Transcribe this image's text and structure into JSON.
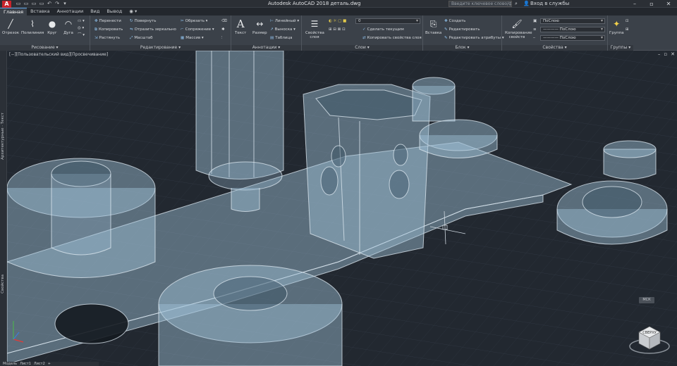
{
  "window": {
    "logo": "A",
    "title": "Autodesk AutoCAD 2018   деталь.dwg",
    "search_placeholder": "Введите ключевое слово/фразу",
    "signin": "Вход в службы"
  },
  "qat": [
    "▭",
    "▭",
    "▭",
    "▭",
    "↶",
    "↷",
    "▾"
  ],
  "tabs": [
    "Главная",
    "Вставка",
    "Аннотации",
    "Вид",
    "Вывод",
    "◉ ▾"
  ],
  "ribbon": {
    "draw": {
      "title": "Рисование ▾",
      "tools": [
        {
          "label": "Отрезок",
          "icon": "╱"
        },
        {
          "label": "Полилиния",
          "icon": "⌇"
        },
        {
          "label": "Круг",
          "icon": "●"
        },
        {
          "label": "Дуга",
          "icon": "◠"
        }
      ],
      "small": [
        "▭ ▾",
        "◎ ▾",
        "⌒ ▾"
      ]
    },
    "modify": {
      "title": "Редактирование ▾",
      "col1": [
        "Перенести",
        "Копировать",
        "Растянуть"
      ],
      "col2": [
        "Повернуть",
        "Отразить зеркально",
        "Масштаб"
      ],
      "col3": [
        "Обрезать ▾",
        "Сопряжение ▾",
        "Массив ▾"
      ]
    },
    "annotate": {
      "title": "Аннотации ▾",
      "text": "Текст",
      "dim": "Размер",
      "col": [
        "Линейный ▾",
        "Выноска ▾",
        "Таблица"
      ]
    },
    "layers": {
      "title": "Слои ▾",
      "props": "Свойства слоя",
      "current": "0",
      "items": [
        "Сделать текущим",
        "Копировать свойства слоя"
      ]
    },
    "block": {
      "title": "Блок ▾",
      "insert": "Вставка",
      "items": [
        "Создать",
        "Редактировать",
        "Редактировать атрибуты ▾"
      ]
    },
    "properties": {
      "title": "Свойства ▾",
      "match": "Копирование свойств",
      "values": [
        "ПоСлою",
        "———— ПоСлою",
        "———— ПоСлою"
      ]
    },
    "groups": {
      "title": "Группы ▾",
      "label": "Группа"
    }
  },
  "viewport": {
    "label": "[−][Пользовательский вид][Просвечивание]",
    "palette_top": "Архитектурные · Текст",
    "palette_bottom": "Свойства",
    "wcs": "МСК",
    "cube": "СВЕРХУ",
    "layout_tabs": [
      "Модель",
      "Лист1",
      "Лист2",
      "+"
    ]
  },
  "colors": {
    "accent": "#5aa0e0",
    "solid_fill": "#9fc0d6",
    "solid_edge": "#dfeaf2",
    "background": "#222830"
  }
}
